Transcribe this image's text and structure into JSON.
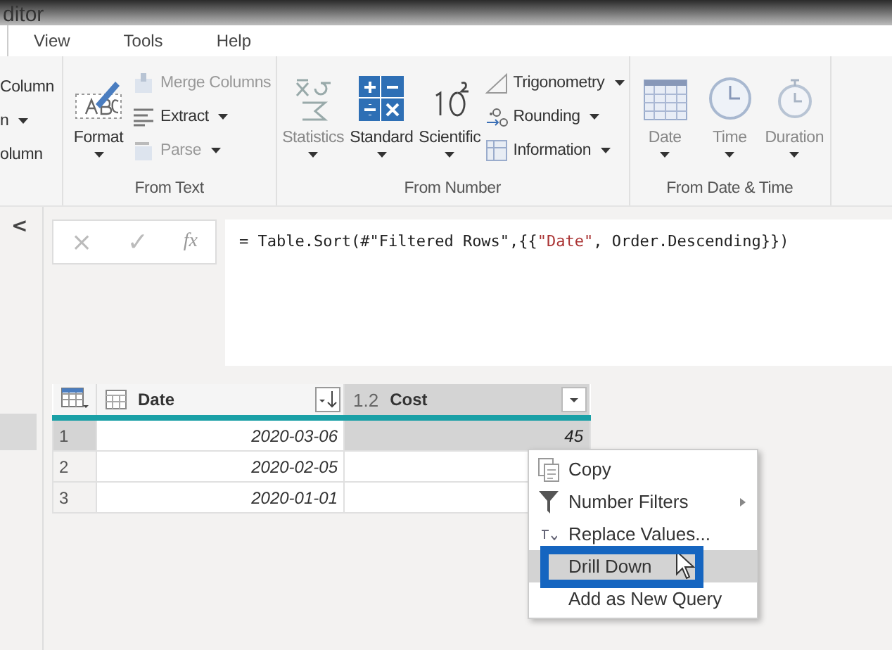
{
  "window": {
    "title": "ditor"
  },
  "tabs": [
    {
      "label": "View",
      "selected": false
    },
    {
      "label": "Tools",
      "selected": false
    },
    {
      "label": "Help",
      "selected": false
    }
  ],
  "ribbon": {
    "partial_items": [
      {
        "label": "Column"
      },
      {
        "label": "n",
        "dropdown": true
      },
      {
        "label": "olumn"
      }
    ],
    "groups": [
      {
        "label": "From Text",
        "large": [
          {
            "label": "Format",
            "kind": "format",
            "disabled": false
          }
        ],
        "small": [
          {
            "label": "Merge Columns",
            "kind": "merge",
            "dropdown": false,
            "disabled": true
          },
          {
            "label": "Extract",
            "kind": "extract",
            "dropdown": true,
            "disabled": false
          },
          {
            "label": "Parse",
            "kind": "parse",
            "dropdown": true,
            "disabled": true
          }
        ]
      },
      {
        "label": "From Number",
        "large": [
          {
            "label": "Statistics",
            "kind": "statistics",
            "disabled": true
          },
          {
            "label": "Standard",
            "kind": "standard",
            "disabled": false
          },
          {
            "label": "Scientific",
            "kind": "scientific",
            "disabled": false
          }
        ],
        "small": [
          {
            "label": "Trigonometry",
            "kind": "trig",
            "dropdown": true,
            "disabled": false
          },
          {
            "label": "Rounding",
            "kind": "rounding",
            "dropdown": true,
            "disabled": false
          },
          {
            "label": "Information",
            "kind": "information",
            "dropdown": true,
            "disabled": false
          }
        ]
      },
      {
        "label": "From Date & Time",
        "large": [
          {
            "label": "Date",
            "kind": "date",
            "disabled": true
          },
          {
            "label": "Time",
            "kind": "time",
            "disabled": true
          },
          {
            "label": "Duration",
            "kind": "duration",
            "disabled": true
          }
        ]
      }
    ]
  },
  "collapse_button": "<",
  "formula_bar": {
    "cancel": "×",
    "confirm": "✓",
    "fx": "fx",
    "formula_before": "= Table.Sort(#\"Filtered Rows\",{{",
    "formula_string": "\"Date\"",
    "formula_after": ", Order.Descending}})"
  },
  "table": {
    "columns": [
      {
        "type": "1.2",
        "name": "Cost",
        "selected": true
      }
    ],
    "date_column": {
      "name": "Date",
      "sorted": true
    },
    "rows": [
      {
        "number": "1",
        "date": "2020-03-06",
        "cost": "45",
        "selected": true
      },
      {
        "number": "2",
        "date": "2020-02-05",
        "cost": "",
        "selected": false
      },
      {
        "number": "3",
        "date": "2020-01-01",
        "cost": "",
        "selected": false
      }
    ]
  },
  "context_menu": {
    "items": [
      {
        "label": "Copy",
        "kind": "copy",
        "submenu": false,
        "selected": false
      },
      {
        "label": "Number Filters",
        "kind": "filter",
        "submenu": true,
        "selected": false
      },
      {
        "label": "Replace Values...",
        "kind": "replace",
        "submenu": false,
        "selected": false
      },
      {
        "label": "Drill Down",
        "kind": "plain",
        "submenu": false,
        "selected": true
      },
      {
        "label": "Add as New Query",
        "kind": "plain",
        "submenu": false,
        "selected": false
      }
    ]
  },
  "highlight": {
    "color": "#1565c0"
  }
}
